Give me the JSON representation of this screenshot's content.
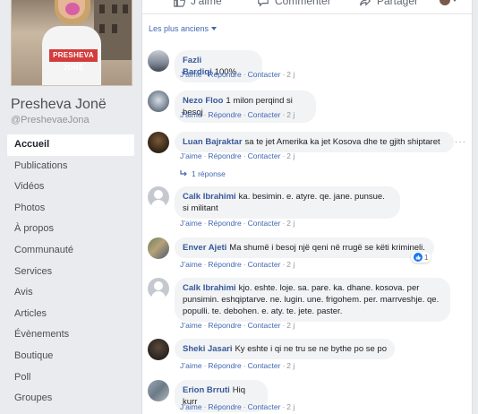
{
  "page": {
    "name": "Presheva Jonë",
    "handle": "@PreshevaeJona",
    "cover_text": "PRESHEVA JONË"
  },
  "nav": [
    {
      "label": "Accueil",
      "active": true
    },
    {
      "label": "Publications"
    },
    {
      "label": "Vidéos"
    },
    {
      "label": "Photos"
    },
    {
      "label": "À propos"
    },
    {
      "label": "Communauté"
    },
    {
      "label": "Services"
    },
    {
      "label": "Avis"
    },
    {
      "label": "Articles"
    },
    {
      "label": "Évènements"
    },
    {
      "label": "Boutique"
    },
    {
      "label": "Poll"
    },
    {
      "label": "Groupes"
    }
  ],
  "actions": {
    "like": "J’aime",
    "comment": "Commenter",
    "share": "Partager"
  },
  "sort_label": "Les plus anciens",
  "comment_meta": {
    "like": "J’aime",
    "reply": "Répondre",
    "contact": "Contacter"
  },
  "comments": [
    {
      "name": "Fazli Bardiqi",
      "text": "100%",
      "time": "2 j"
    },
    {
      "name": "Nezo Floo",
      "text": "1 milon perqind si besoj",
      "time": "2 j"
    },
    {
      "name": "Luan Bajraktar",
      "text": "sa te jet Amerika ka jet Kosova dhe te gjith shiptaret",
      "time": "2 j",
      "replies": "1 réponse"
    },
    {
      "name": "Calk Ibrahimi",
      "text": "ka. besimin. e. atyre. qe. jane. punsue. si militant",
      "time": "2 j"
    },
    {
      "name": "Enver Ajeti",
      "text": "Ma shumë i besoj një qeni në rrugë se këti krimineli.",
      "time": "2 j",
      "reactions": "1"
    },
    {
      "name": "Calk Ibrahimi",
      "text": "kjo. eshte. loje. sa. pare. ka. dhane. kosova. per punsimin. eshqiptarve. ne. lugin. une. frigohem. per. marrveshje. qe. populli. te. debohen. e. aty. te. jete. paster.",
      "time": "2 j"
    },
    {
      "name": "Sheki Jasari",
      "text": "Ky eshte i qi ne tru se ne bythe po se po",
      "time": "2 j"
    },
    {
      "name": "Erion Brruti",
      "text": "Hiq kurr",
      "time": "2 j"
    }
  ],
  "colors": {
    "link": "#385898",
    "meta_link": "#4267b2",
    "bubble": "#f2f3f5",
    "background": "#e9ebee"
  }
}
